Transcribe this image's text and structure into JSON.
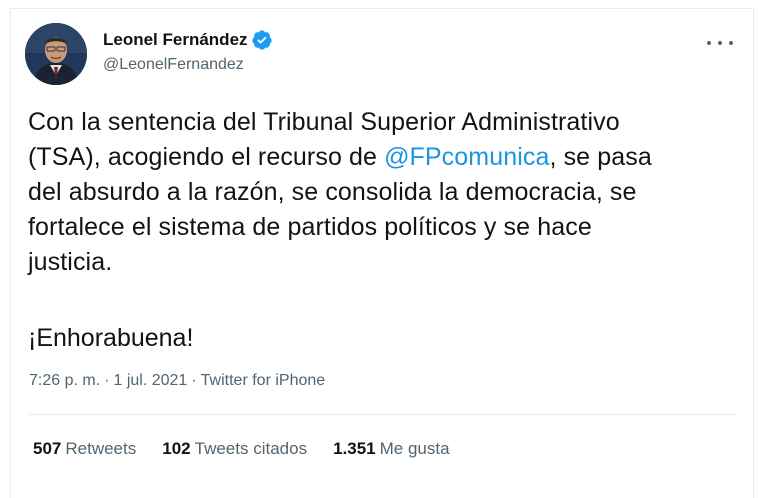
{
  "author": {
    "display_name": "Leonel Fernández",
    "handle": "@LeonelFernandez",
    "verified": true,
    "verified_color": "#1d9bf0"
  },
  "tweet": {
    "text_line1_a": "Con la sentencia del Tribunal Superior Administrativo",
    "text_line2_a": "(TSA), acogiendo el recurso de ",
    "mention": "@FPcomunica",
    "text_line2_b": ", se pasa",
    "text_line3": "del absurdo a la razón, se consolida la democracia, se",
    "text_line4": "fortalece el sistema de partidos políticos y se hace",
    "text_line5": "justicia.",
    "exclaim": "¡Enhorabuena!",
    "mention_color": "#1b95e0"
  },
  "meta": {
    "time": "7:26 p. m.",
    "separator": "·",
    "date": "1 jul. 2021",
    "source": "Twitter for iPhone"
  },
  "stats": {
    "retweets_count": "507",
    "retweets_label": "Retweets",
    "quotes_count": "102",
    "quotes_label": "Tweets citados",
    "likes_count": "1.351",
    "likes_label": "Me gusta"
  },
  "icons": {
    "more": "more-options-icon",
    "verified": "verified-badge-icon"
  }
}
